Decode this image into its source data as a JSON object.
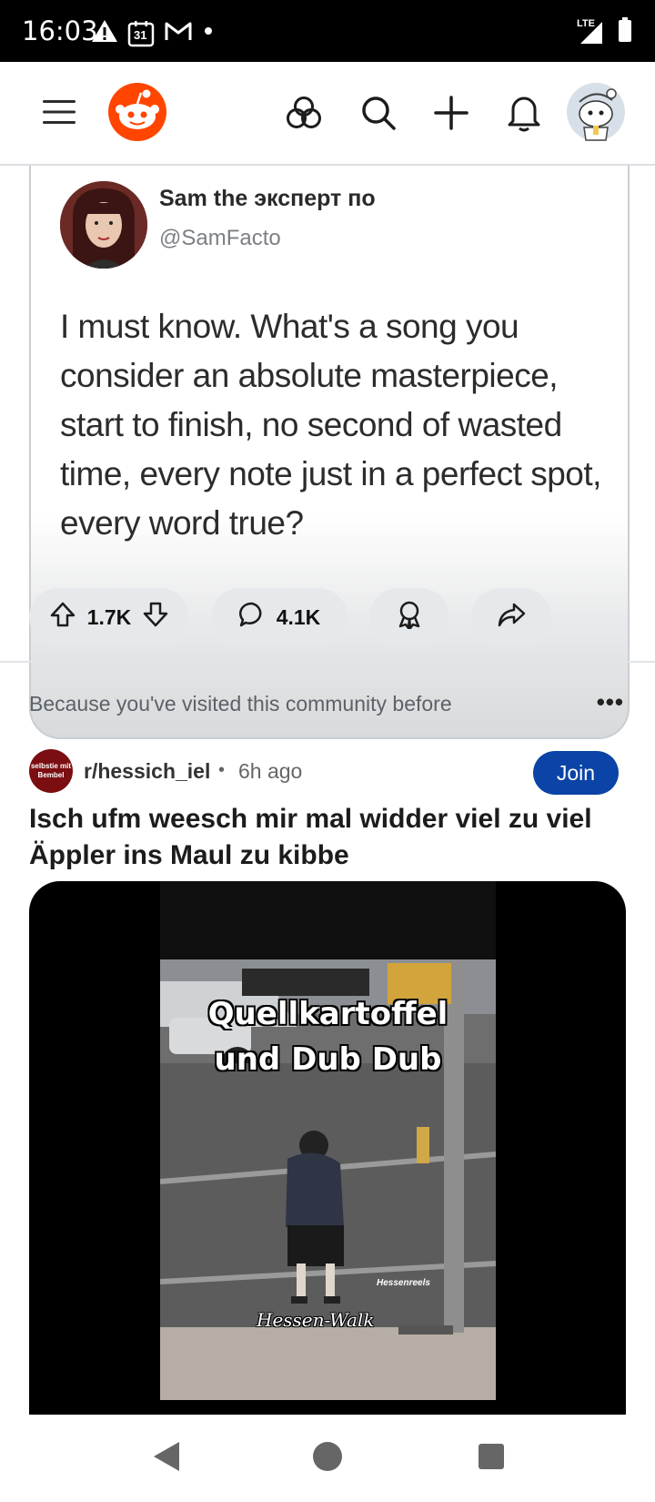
{
  "status_bar": {
    "time": "16:03",
    "calendar_day": "31",
    "network": "LTE"
  },
  "app_bar": {
    "icons": [
      "menu-icon",
      "reddit-logo-icon",
      "communities-icon",
      "search-icon",
      "create-icon",
      "notifications-icon",
      "avatar"
    ]
  },
  "tweet_post": {
    "author_name": "Sam the эксперт по",
    "author_handle": "@SamFacto",
    "text": "I must know. What's a song you consider an absolute masterpiece, start to finish, no second of wasted time, every note just in a perfect spot, every word true?",
    "votes": "1.7K",
    "comments": "4.1K"
  },
  "recommendation": {
    "reason": "Because you've visited this community before",
    "more_label": "•••",
    "subreddit": "r/hessich_iel",
    "separator": "•",
    "time_ago": "6h ago",
    "join_label": "Join",
    "subreddit_avatar_text": "selbstie mit Bembel",
    "title": "Isch ufm weesch mir mal widder viel zu viel Äppler ins Maul zu kibbe",
    "video": {
      "caption_line1": "Quellkartoffel",
      "caption_line2": "und Dub Dub",
      "watermark": "Hessenreels",
      "subtitle": "Hessen-Walk"
    }
  },
  "colors": {
    "reddit_orange": "#ff4500",
    "join_blue": "#0b44a6",
    "pill_gray": "#e6e9ec"
  },
  "nav_bar": {
    "buttons": [
      "back-icon",
      "home-icon",
      "recents-icon"
    ]
  }
}
